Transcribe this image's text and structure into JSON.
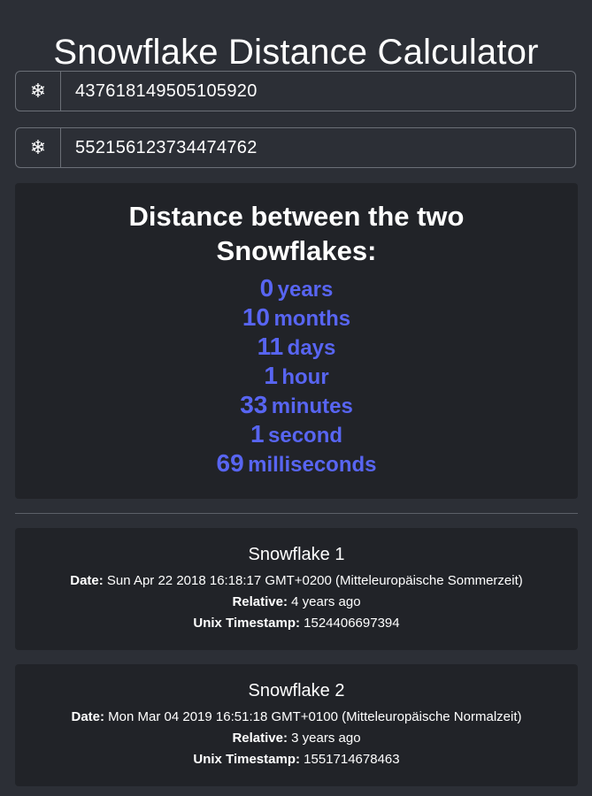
{
  "title": "Snowflake Distance Calculator",
  "inputs": {
    "snowflake_icon": "snowflake-icon",
    "first_value": "437618149505105920",
    "second_value": "552156123734474762"
  },
  "result": {
    "heading": "Distance between the two Snowflakes:",
    "durations": [
      {
        "value": "0",
        "unit": "years"
      },
      {
        "value": "10",
        "unit": "months"
      },
      {
        "value": "11",
        "unit": "days"
      },
      {
        "value": "1",
        "unit": "hour"
      },
      {
        "value": "33",
        "unit": "minutes"
      },
      {
        "value": "1",
        "unit": "second"
      },
      {
        "value": "69",
        "unit": "milliseconds"
      }
    ],
    "accent_color": "#5865f2"
  },
  "snowflakes": [
    {
      "title": "Snowflake 1",
      "date_label": "Date:",
      "date": "Sun Apr 22 2018 16:18:17 GMT+0200 (Mitteleuropäische Sommerzeit)",
      "relative_label": "Relative:",
      "relative": "4 years ago",
      "timestamp_label": "Unix Timestamp:",
      "timestamp": "1524406697394"
    },
    {
      "title": "Snowflake 2",
      "date_label": "Date:",
      "date": "Mon Mar 04 2019 16:51:18 GMT+0100 (Mitteleuropäische Normalzeit)",
      "relative_label": "Relative:",
      "relative": "3 years ago",
      "timestamp_label": "Unix Timestamp:",
      "timestamp": "1551714678463"
    }
  ]
}
